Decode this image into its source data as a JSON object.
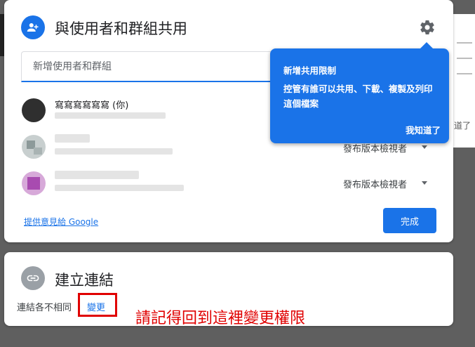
{
  "share_dialog": {
    "title": "與使用者和群組共用",
    "input_placeholder": "新增使用者和群組",
    "people": [
      {
        "name": "寫寫寫寫寫寫 (你)",
        "role": ""
      },
      {
        "name": "",
        "role": "發布版本檢視者"
      },
      {
        "name": "",
        "role": "發布版本檢視者"
      }
    ],
    "feedback_link": "提供意見給 Google",
    "done_button": "完成"
  },
  "tooltip": {
    "title": "新增共用限制",
    "body": "控管有誰可以共用、下載、複製及列印這個檔案",
    "ok": "我知道了"
  },
  "link_dialog": {
    "title": "建立連結",
    "description": "連結各不相同",
    "change_link": "變更"
  },
  "annotation": "請記得回到這裡變更權限",
  "background": {
    "partial_text": "道了"
  },
  "colors": {
    "accent": "#1a73e8",
    "annotation_red": "#e00000"
  }
}
